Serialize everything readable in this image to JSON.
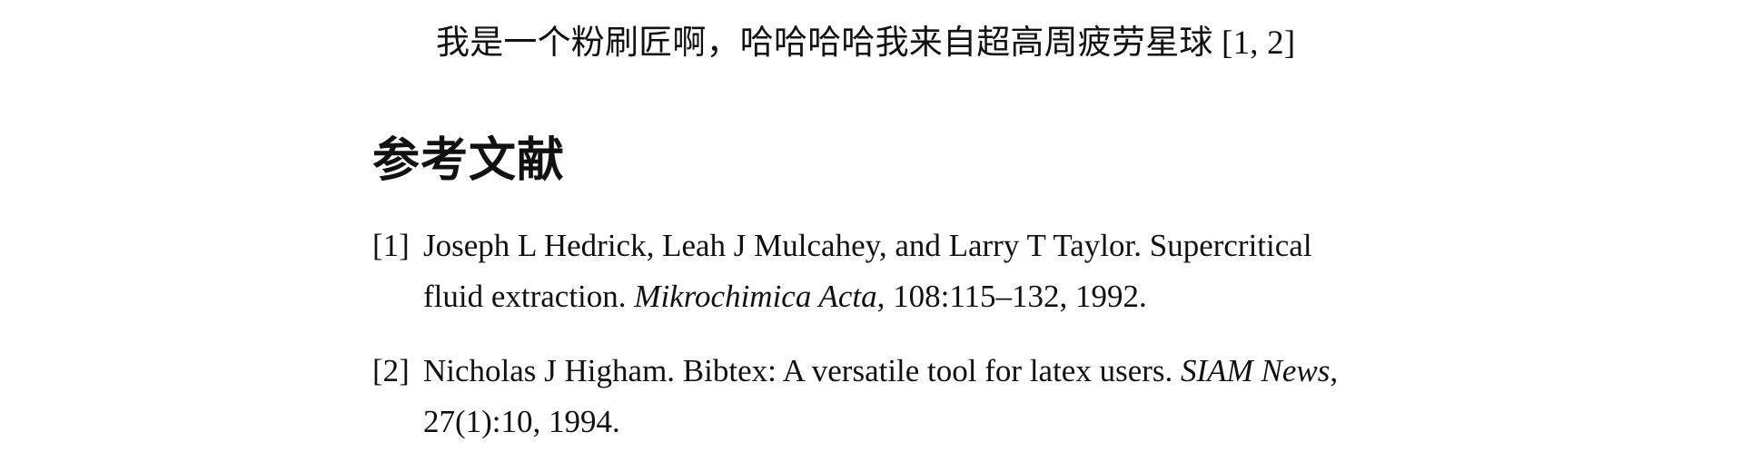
{
  "paper": {
    "body_text": "我是一个粉刷匠啊，哈哈哈哈我来自超高周疲劳星球 [1, 2]",
    "references_title": "参考文献",
    "references": [
      {
        "label": "[1]",
        "line1": "Joseph L Hedrick, Leah J Mulcahey, and Larry T Taylor. Supercritical",
        "line2_before": "fluid extraction. ",
        "journal": "Mikrochimica Acta",
        "line2_after": ", 108:115–132, 1992."
      },
      {
        "label": "[2]",
        "line1_before": "Nicholas J Higham. Bibtex: A versatile tool for latex users. ",
        "journal": "SIAM News",
        "line1_after": ",",
        "line2": "27(1):10, 1994."
      }
    ]
  }
}
